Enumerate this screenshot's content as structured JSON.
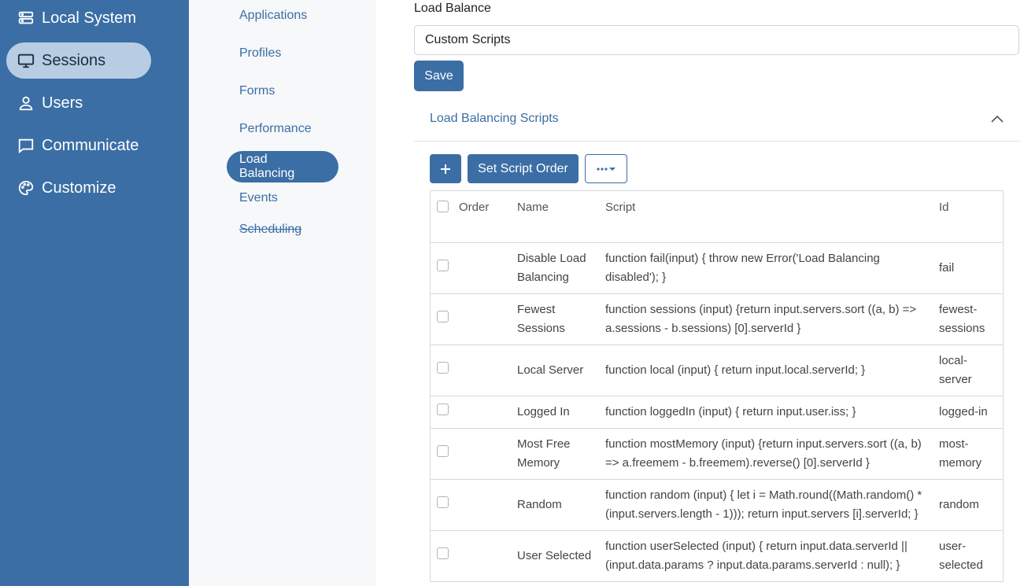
{
  "sidebar": {
    "items": [
      {
        "label": "Local System",
        "icon": "server-icon"
      },
      {
        "label": "Sessions",
        "icon": "monitor-icon",
        "active": true
      },
      {
        "label": "Users",
        "icon": "user-icon"
      },
      {
        "label": "Communicate",
        "icon": "chat-icon"
      },
      {
        "label": "Customize",
        "icon": "palette-icon"
      }
    ]
  },
  "subnav": {
    "items": [
      {
        "label": "Applications"
      },
      {
        "label": "Profiles"
      },
      {
        "label": "Forms"
      },
      {
        "label": "Performance"
      },
      {
        "label": "Load Balancing",
        "active": true
      },
      {
        "label": "Events"
      },
      {
        "label": "Scheduling",
        "strikethrough": true
      }
    ]
  },
  "main": {
    "load_balance_label": "Load Balance",
    "load_balance_value": "Custom Scripts",
    "save_label": "Save",
    "section_title": "Load Balancing Scripts",
    "toolbar": {
      "add_icon": "plus-icon",
      "set_order_label": "Set Script Order",
      "more_icon": "more-dots-icon"
    },
    "table": {
      "headers": [
        "Order",
        "Name",
        "Script",
        "Id"
      ],
      "rows": [
        {
          "order": "",
          "name": "Disable Load Balancing",
          "script": "function fail(input) { throw new Error('Load Balancing disabled'); }",
          "id": "fail"
        },
        {
          "order": "",
          "name": "Fewest Sessions",
          "script": "function sessions (input) {return input.servers.sort ((a, b) => a.sessions - b.sessions) [0].serverId }",
          "id": "fewest-sessions"
        },
        {
          "order": "",
          "name": "Local Server",
          "script": "function local (input) { return input.local.serverId; }",
          "id": "local-server"
        },
        {
          "order": "",
          "name": "Logged In",
          "script": "function loggedIn (input) { return input.user.iss; }",
          "id": "logged-in"
        },
        {
          "order": "",
          "name": "Most Free Memory",
          "script": "function mostMemory (input) {return input.servers.sort ((a, b) => a.freemem - b.freemem).reverse() [0].serverId }",
          "id": "most-memory"
        },
        {
          "order": "",
          "name": "Random",
          "script": "function random (input) { let i = Math.round((Math.random() * (input.servers.length - 1))); return input.servers [i].serverId; }",
          "id": "random"
        },
        {
          "order": "",
          "name": "User Selected",
          "script": "function userSelected (input) { return input.data.serverId || (input.data.params ? input.data.params.serverId : null); }",
          "id": "user-selected"
        }
      ]
    }
  },
  "colors": {
    "primary": "#3b6ea5",
    "active_side": "#b8cde3",
    "subnav_bg": "#f6f8fa"
  }
}
